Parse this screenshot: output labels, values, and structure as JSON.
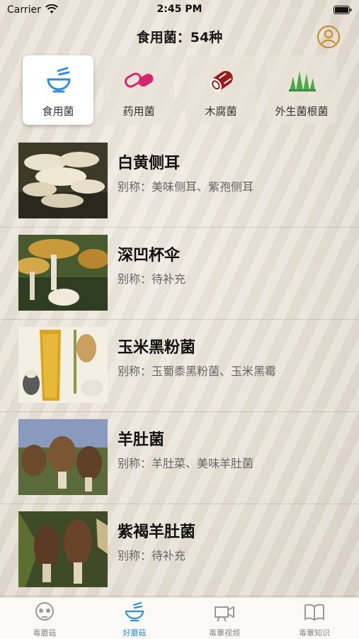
{
  "status": {
    "carrier": "Carrier",
    "time": "2:45 PM"
  },
  "header": {
    "title": "食用菌：54种"
  },
  "categories": [
    {
      "label": "食用菌",
      "icon": "bowl-icon",
      "active": true
    },
    {
      "label": "药用菌",
      "icon": "pill-icon",
      "active": false
    },
    {
      "label": "木腐菌",
      "icon": "log-icon",
      "active": false
    },
    {
      "label": "外生菌根菌",
      "icon": "grass-icon",
      "active": false
    }
  ],
  "mushrooms": [
    {
      "name": "白黄侧耳",
      "alias": "别称：美味侧耳、紫孢侧耳"
    },
    {
      "name": "深凹杯伞",
      "alias": "别称：待补充"
    },
    {
      "name": "玉米黑粉菌",
      "alias": "别称：玉蜀黍黑粉菌、玉米黑霉"
    },
    {
      "name": "羊肚菌",
      "alias": "别称：羊肚菜、美味羊肚菌"
    },
    {
      "name": "紫褐羊肚菌",
      "alias": "别称：待补充"
    }
  ],
  "tabs": [
    {
      "label": "毒蘑菇",
      "icon": "skull-icon",
      "active": false
    },
    {
      "label": "好蘑菇",
      "icon": "bowl-icon",
      "active": true
    },
    {
      "label": "毒蕈视频",
      "icon": "video-camera-icon",
      "active": false
    },
    {
      "label": "毒蕈知识",
      "icon": "book-icon",
      "active": false
    }
  ],
  "colors": {
    "accent": "#2f8fd6",
    "pill": "#d6246e",
    "log": "#9b1b1b",
    "grass": "#4aa84a",
    "profile": "#c98f2f"
  }
}
